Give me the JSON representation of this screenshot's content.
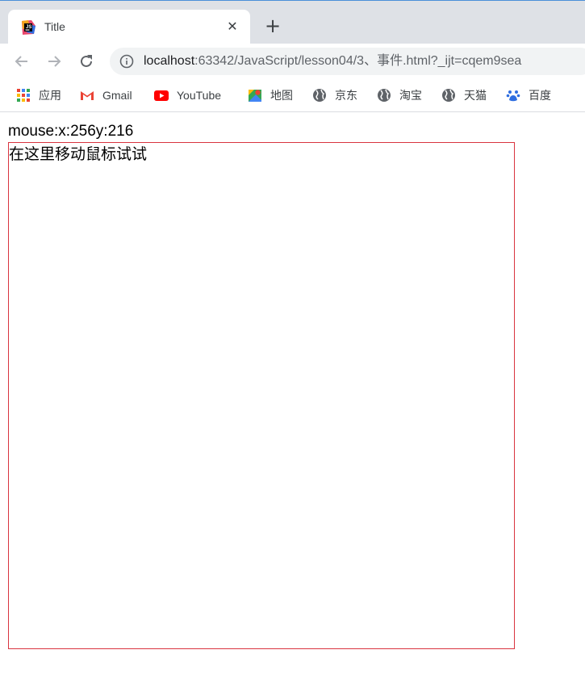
{
  "tab": {
    "title": "Title",
    "close_label": "✕",
    "favicon": "intellij-icon"
  },
  "new_tab_label": "+",
  "nav": {
    "back": "back-arrow-icon",
    "forward": "forward-arrow-icon",
    "reload": "reload-icon"
  },
  "omnibox": {
    "host": "localhost",
    "rest": ":63342/JavaScript/lesson04/3、事件.html?_ijt=cqem9sea"
  },
  "bookmarks": [
    {
      "label": "应用",
      "icon": "apps-grid-icon"
    },
    {
      "label": "Gmail",
      "icon": "gmail-icon"
    },
    {
      "label": "YouTube",
      "icon": "youtube-icon"
    },
    {
      "label": "地图",
      "icon": "maps-icon"
    },
    {
      "label": "京东",
      "icon": "globe-icon"
    },
    {
      "label": "淘宝",
      "icon": "globe-icon"
    },
    {
      "label": "天猫",
      "icon": "globe-icon"
    },
    {
      "label": "百度",
      "icon": "baidu-paw-icon"
    }
  ],
  "page": {
    "readout": "mouse:x:256y:216",
    "box_text": "在这里移动鼠标试试",
    "box_border_color": "#d9343f"
  }
}
